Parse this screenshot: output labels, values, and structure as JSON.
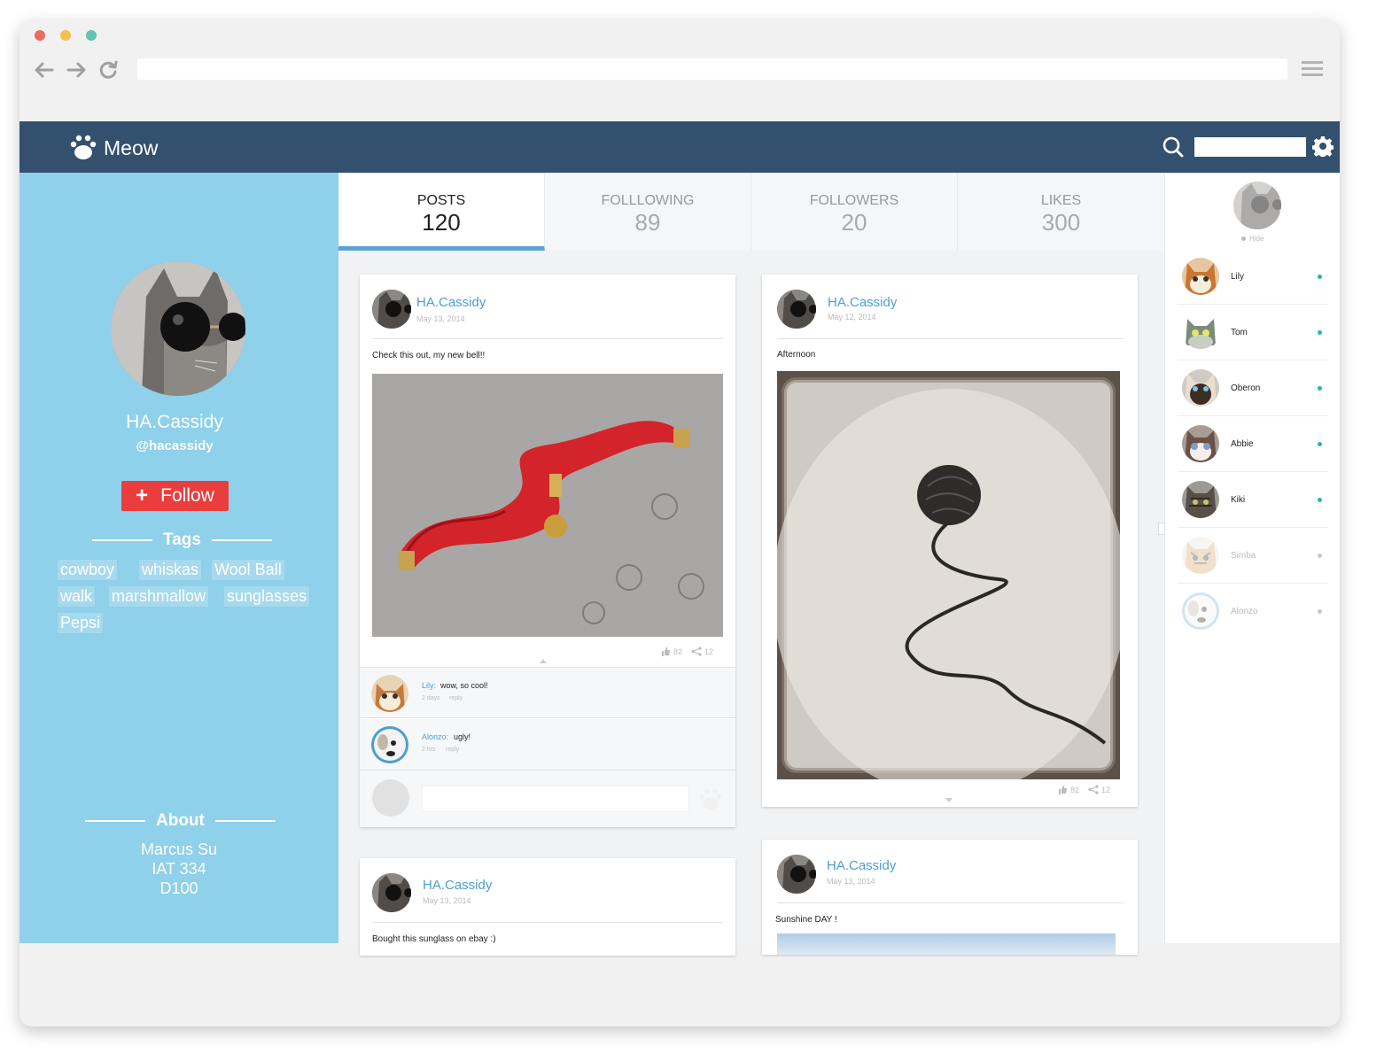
{
  "browser": {
    "traffic_lights": [
      "#ec6a5e",
      "#f4bf4f",
      "#61c4b5"
    ],
    "nav": {
      "back_icon": "arrow-left-icon",
      "forward_icon": "arrow-right-icon",
      "reload_icon": "reload-icon"
    },
    "url": "",
    "menu_icon": "hamburger-icon"
  },
  "header": {
    "brand": "Meow",
    "logo_icon": "paw-icon",
    "search_placeholder": "",
    "bg_color": "#34506f"
  },
  "profile": {
    "name": "HA.Cassidy",
    "handle": "@hacassidy",
    "follow_label": "Follow",
    "tags_heading": "Tags",
    "tags": [
      "cowboy",
      "whiskas",
      "Wool Ball",
      "walk",
      "marshmallow",
      "sunglasses",
      "Pepsi"
    ],
    "about_heading": "About",
    "about_lines": [
      "Marcus Su",
      "IAT 334",
      "D100"
    ],
    "sidebar_color": "#8fd0ea",
    "follow_color": "#ea3d3d"
  },
  "stats": [
    {
      "label": "POSTS",
      "count": "120",
      "active": true
    },
    {
      "label": "FOLLLOWING",
      "count": "89",
      "active": false
    },
    {
      "label": "FOLLOWERS",
      "count": "20",
      "active": false
    },
    {
      "label": "LIKES",
      "count": "300",
      "active": false
    }
  ],
  "posts": [
    {
      "author": "HA.Cassidy",
      "date": "May 13, 2014",
      "text": "Check this out, my new bell!!",
      "likes": "82",
      "shares": "12",
      "comments": [
        {
          "name": "Lily:",
          "text": "wow, so cool!",
          "time": "2 days",
          "reply": "reply"
        },
        {
          "name": "Alonzo:",
          "text": "ugly!",
          "time": "2 hrs",
          "reply": "reply"
        }
      ]
    },
    {
      "author": "HA.Cassidy",
      "date": "May 12, 2014",
      "text": "Afternoon",
      "likes": "82",
      "shares": "12"
    },
    {
      "author": "HA.Cassidy",
      "date": "May 13, 2014",
      "text": "Bought this sunglass on ebay :)"
    },
    {
      "author": "HA.Cassidy",
      "date": "May 13, 2014",
      "text": "Sunshine DAY !"
    }
  ],
  "friends": {
    "hide_label": "Hide",
    "list": [
      {
        "name": "Lily",
        "online": true
      },
      {
        "name": "Tom",
        "online": true
      },
      {
        "name": "Oberon",
        "online": true
      },
      {
        "name": "Abbie",
        "online": true
      },
      {
        "name": "Kiki",
        "online": true
      },
      {
        "name": "Simba",
        "online": false
      },
      {
        "name": "Alonzo",
        "online": false
      }
    ],
    "online_color": "#2bb5a7",
    "offline_color": "#c8c8c8"
  }
}
